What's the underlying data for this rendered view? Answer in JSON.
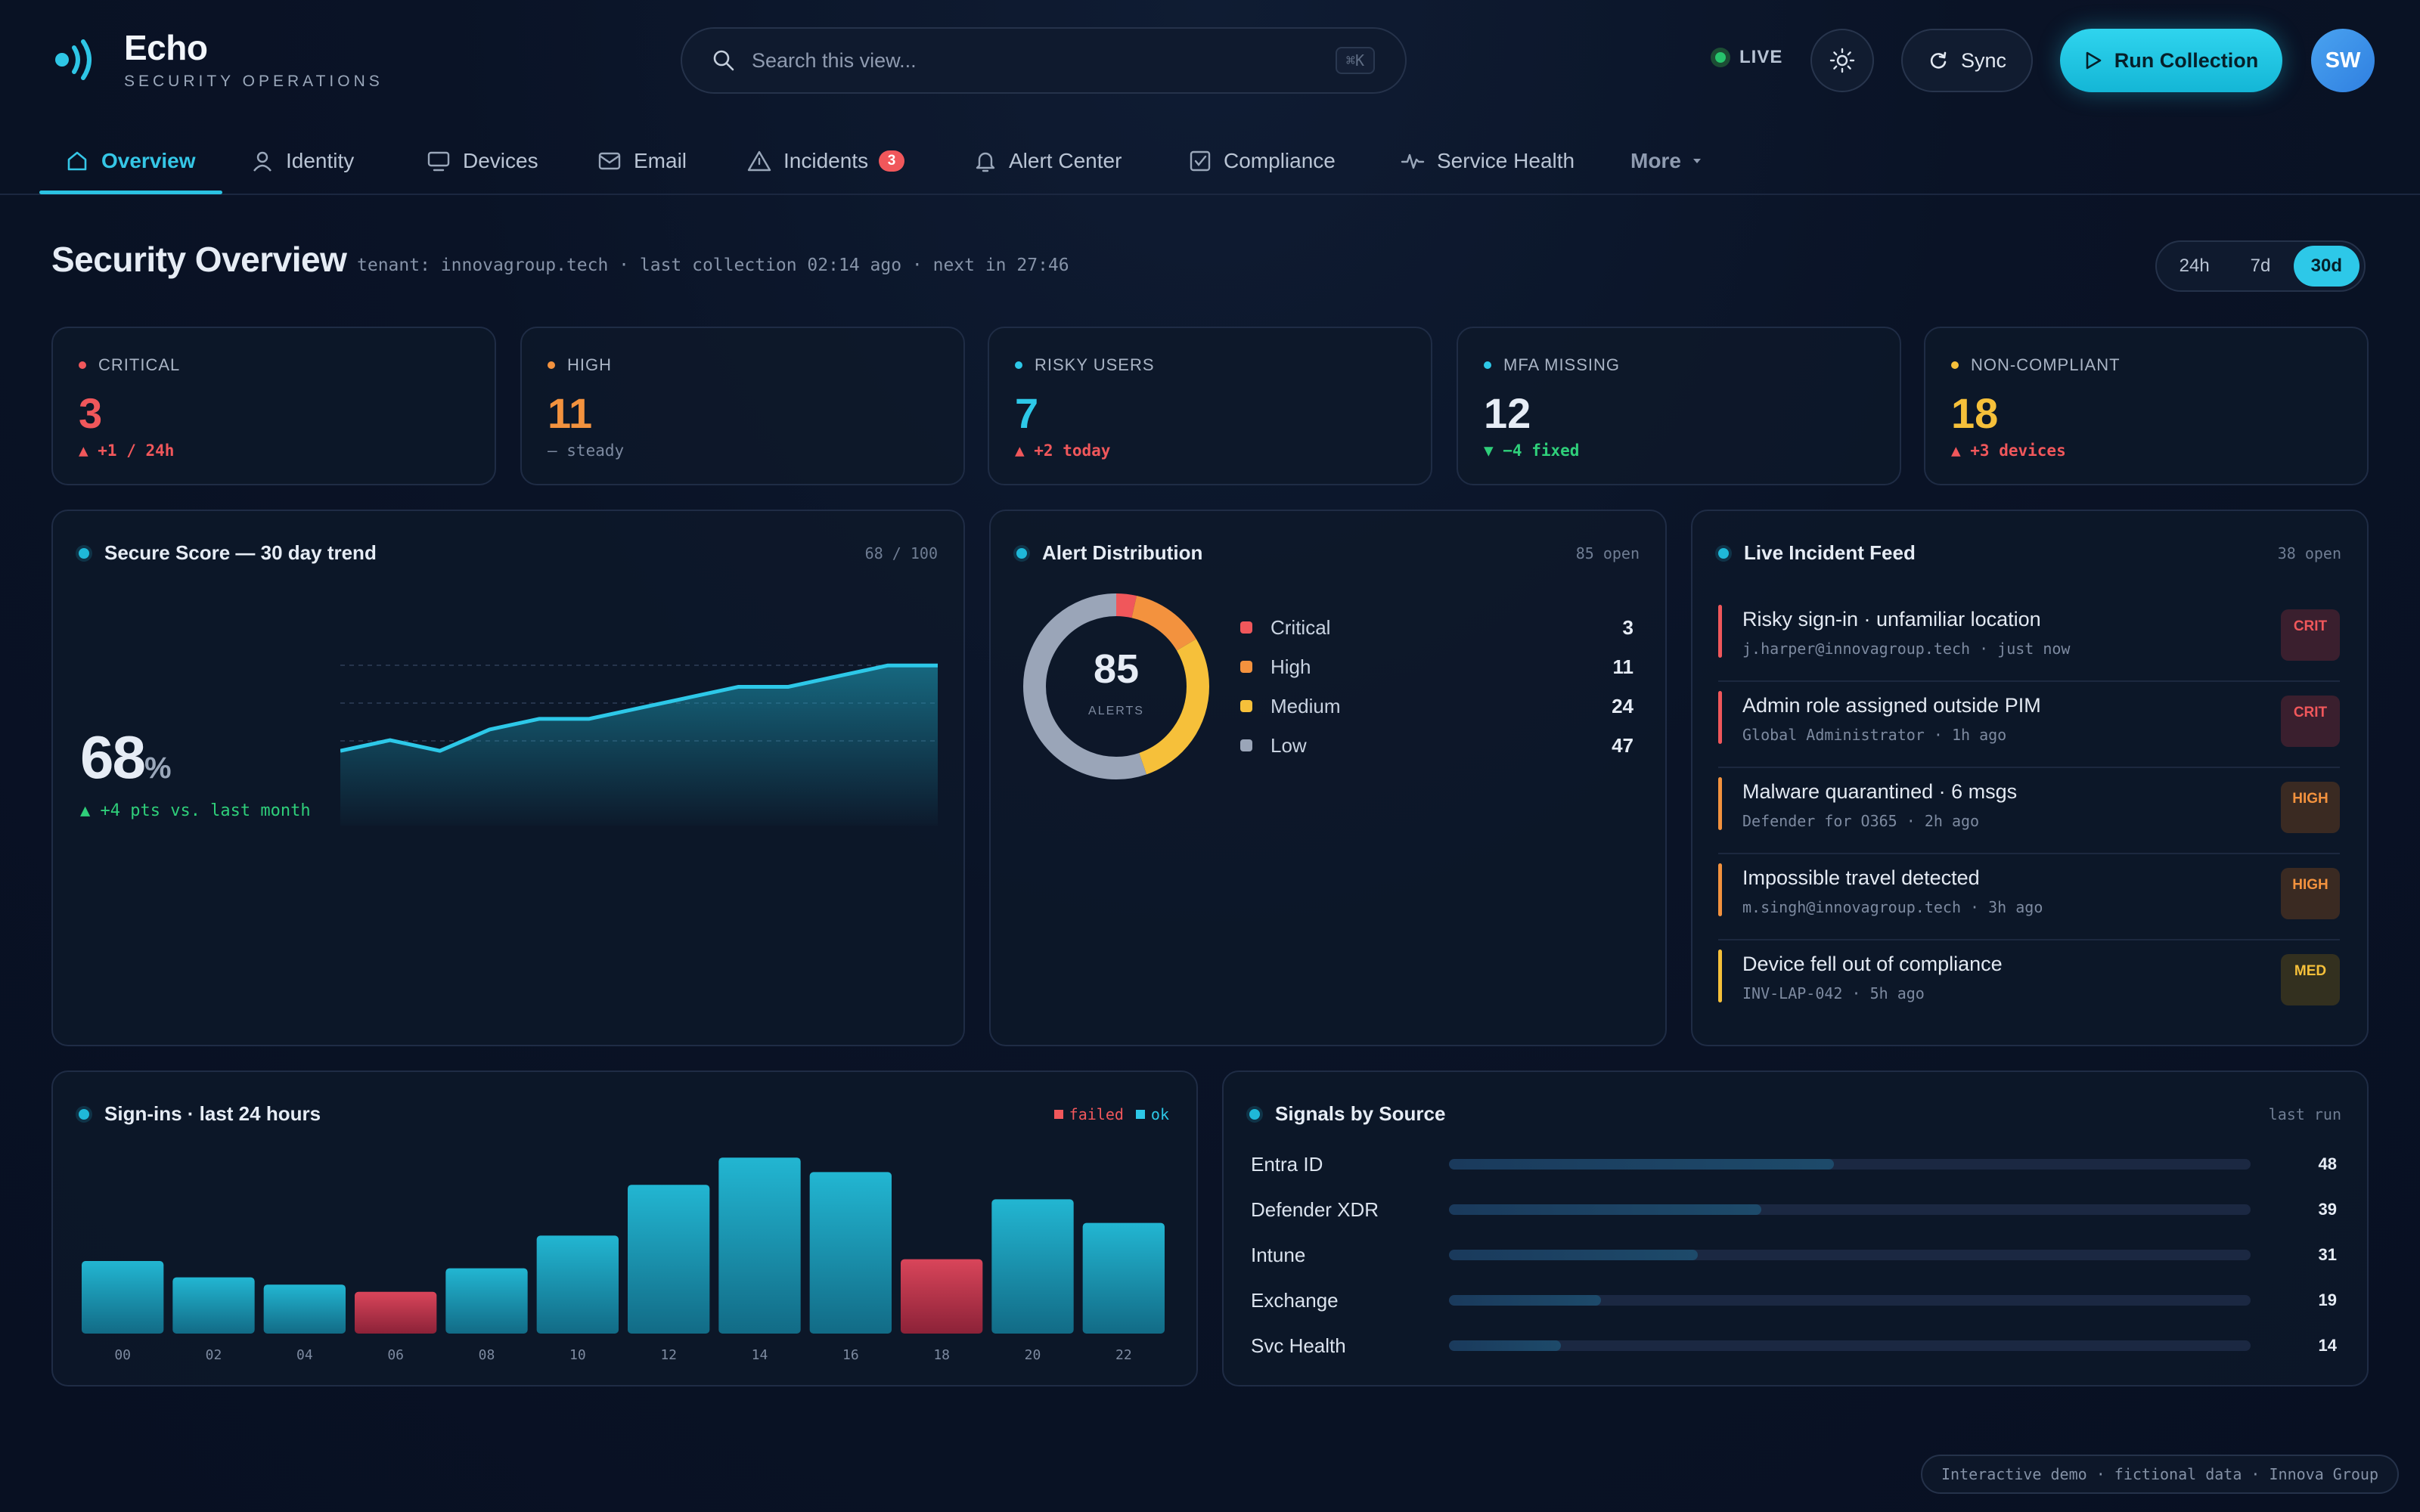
{
  "brand": {
    "name": "Echo",
    "subtitle": "SECURITY OPERATIONS"
  },
  "search": {
    "placeholder": "Search this view...",
    "shortcut": "⌘K"
  },
  "header": {
    "live_label": "LIVE",
    "sync_label": "Sync",
    "run_label": "Run Collection",
    "avatar_initials": "SW"
  },
  "nav": {
    "tabs": [
      {
        "label": "Overview",
        "icon": "home-icon",
        "active": true
      },
      {
        "label": "Identity",
        "icon": "user-icon"
      },
      {
        "label": "Devices",
        "icon": "monitor-icon"
      },
      {
        "label": "Email",
        "icon": "mail-icon"
      },
      {
        "label": "Incidents",
        "icon": "warning-icon",
        "badge": "3"
      },
      {
        "label": "Alert Center",
        "icon": "bell-icon"
      },
      {
        "label": "Compliance",
        "icon": "checkbox-icon"
      },
      {
        "label": "Service Health",
        "icon": "pulse-icon"
      },
      {
        "label": "More",
        "icon": "caret-down-icon"
      }
    ]
  },
  "page": {
    "title": "Security Overview",
    "meta": "tenant: innovagroup.tech · last collection 02:14 ago · next in 27:46",
    "ranges": [
      "24h",
      "7d",
      "30d"
    ],
    "active_range": "30d"
  },
  "stats": [
    {
      "label": "CRITICAL",
      "value": "3",
      "delta": "▲ +1 / 24h",
      "color": "#f0575b",
      "delta_color": "#f0575b"
    },
    {
      "label": "HIGH",
      "value": "11",
      "delta": "— steady",
      "color": "#f3923e",
      "delta_color": "#7d8aa0"
    },
    {
      "label": "RISKY USERS",
      "value": "7",
      "delta": "▲ +2 today",
      "color": "#2dc8e8",
      "delta_color": "#f0575b"
    },
    {
      "label": "MFA MISSING",
      "value": "12",
      "delta": "▼ −4 fixed",
      "color": "#e6ecf5",
      "delta_color": "#2fcf7a"
    },
    {
      "label": "NON-COMPLIANT",
      "value": "18",
      "delta": "▲ +3 devices",
      "color": "#f6c03a",
      "delta_color": "#f0575b"
    }
  ],
  "secure_score": {
    "title": "Secure Score — 30 day trend",
    "right": "68 / 100",
    "value": "68",
    "unit": "%",
    "delta": "▲ +4 pts vs. last month",
    "trend": [
      62,
      63,
      62,
      64,
      65,
      65,
      66,
      67,
      68,
      68,
      69,
      70,
      70
    ]
  },
  "alerts": {
    "title": "Alert Distribution",
    "right": "85 open",
    "total": "85",
    "total_label": "ALERTS",
    "items": [
      {
        "label": "Critical",
        "value": 3,
        "color": "#f0575b"
      },
      {
        "label": "High",
        "value": 11,
        "color": "#f3923e"
      },
      {
        "label": "Medium",
        "value": 24,
        "color": "#f6c03a"
      },
      {
        "label": "Low",
        "value": 47,
        "color": "#9aa5b8"
      }
    ]
  },
  "feed": {
    "title": "Live Incident Feed",
    "right": "38 open",
    "items": [
      {
        "title": "Risky sign-in · unfamiliar location",
        "sub": "j.harper@innovagroup.tech · just now",
        "tag": "CRIT",
        "color": "#f0575b"
      },
      {
        "title": "Admin role assigned outside PIM",
        "sub": "Global Administrator · 1h ago",
        "tag": "CRIT",
        "color": "#f0575b"
      },
      {
        "title": "Malware quarantined · 6 msgs",
        "sub": "Defender for O365 · 2h ago",
        "tag": "HIGH",
        "color": "#f3923e"
      },
      {
        "title": "Impossible travel detected",
        "sub": "m.singh@innovagroup.tech · 3h ago",
        "tag": "HIGH",
        "color": "#f3923e"
      },
      {
        "title": "Device fell out of compliance",
        "sub": "INV-LAP-042 · 5h ago",
        "tag": "MED",
        "color": "#f6c03a"
      }
    ]
  },
  "signins": {
    "title": "Sign-ins · last 24 hours",
    "legend_failed": "failed",
    "legend_ok": "ok"
  },
  "chart_data": {
    "type": "bar",
    "title": "Sign-ins · last 24 hours",
    "categories": [
      "00",
      "02",
      "04",
      "06",
      "08",
      "10",
      "12",
      "14",
      "16",
      "18",
      "20",
      "22"
    ],
    "values": [
      40,
      31,
      27,
      23,
      36,
      54,
      82,
      97,
      89,
      41,
      74,
      61
    ],
    "status": [
      "ok",
      "ok",
      "ok",
      "failed",
      "ok",
      "ok",
      "ok",
      "ok",
      "ok",
      "failed",
      "ok",
      "ok"
    ],
    "legend": [
      "failed",
      "ok"
    ],
    "colors": {
      "ok": "#1eaac6",
      "failed": "#d23a4f"
    },
    "ylim": [
      0,
      100
    ]
  },
  "signals": {
    "title": "Signals by Source",
    "right": "last run",
    "items": [
      {
        "label": "Entra ID",
        "value": 48
      },
      {
        "label": "Defender XDR",
        "value": 39
      },
      {
        "label": "Intune",
        "value": 31
      },
      {
        "label": "Exchange",
        "value": 19
      },
      {
        "label": "Svc Health",
        "value": 14
      }
    ]
  },
  "footer": {
    "note": "Interactive demo · fictional data · Innova Group"
  }
}
